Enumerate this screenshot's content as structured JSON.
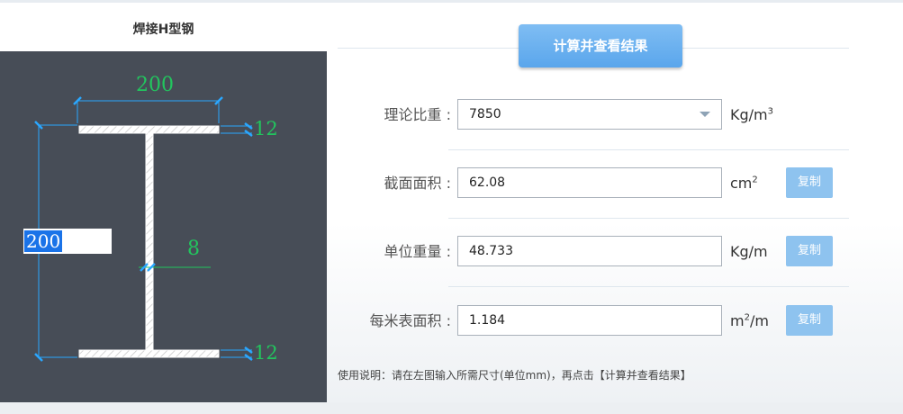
{
  "left_panel": {
    "title": "焊接H型钢",
    "dims": {
      "top_width": "200",
      "top_flange_thk": "12",
      "web_thk": "8",
      "bottom_flange_thk": "12",
      "height_input": "200"
    }
  },
  "calc_button_label": "计算并查看结果",
  "rows": [
    {
      "label": "理论比重 :",
      "value": "7850",
      "unit": "Kg/m",
      "unit_sup": "3",
      "type": "select"
    },
    {
      "label": "截面面积 :",
      "value": "62.08",
      "unit": "cm",
      "unit_sup": "2",
      "copy": "复制"
    },
    {
      "label": "单位重量 :",
      "value": "48.733",
      "unit": "Kg/m",
      "copy": "复制"
    },
    {
      "label": "每米表面积 :",
      "value": "1.184",
      "unit_pre": "m",
      "unit_sup": "2",
      "unit_post": "/m",
      "copy": "复制"
    }
  ],
  "note": "使用说明：请在左图输入所需尺寸(单位mm)，再点击【计算并查看结果】",
  "colors": {
    "drawing_bg": "#474d57",
    "dimension_green": "#22c55e",
    "dimension_blue": "#2aa7ff",
    "button_blue": "#5aa6ec",
    "copy_blue": "#8ec3ef"
  }
}
